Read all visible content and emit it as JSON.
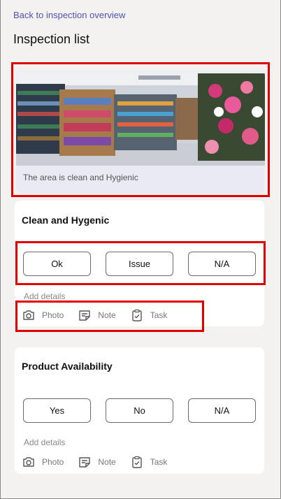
{
  "nav": {
    "back_label": "Back to inspection overview"
  },
  "page": {
    "title": "Inspection list"
  },
  "hero": {
    "caption": "The area is clean and Hygienic"
  },
  "items": [
    {
      "title": "Clean and Hygenic",
      "options": [
        "Ok",
        "Issue",
        "N/A"
      ],
      "add_details": "Add details",
      "actions": {
        "photo": "Photo",
        "note": "Note",
        "task": "Task"
      }
    },
    {
      "title": "Product Availability",
      "options": [
        "Yes",
        "No",
        "N/A"
      ],
      "add_details": "Add details",
      "actions": {
        "photo": "Photo",
        "note": "Note",
        "task": "Task"
      }
    }
  ],
  "colors": {
    "link": "#4f52b2",
    "highlight": "#e00000",
    "background": "#f3f2f1"
  },
  "icons": [
    "camera-icon",
    "note-icon",
    "task-clipboard-icon"
  ]
}
